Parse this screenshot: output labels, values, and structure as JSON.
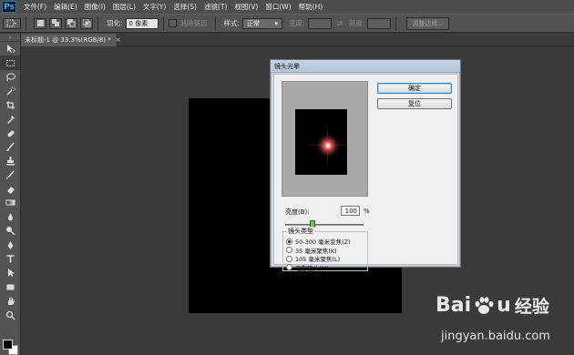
{
  "app": {
    "logo": "Ps"
  },
  "menu": [
    "文件(F)",
    "编辑(E)",
    "图像(I)",
    "图层(L)",
    "文字(Y)",
    "选择(S)",
    "滤镜(T)",
    "视图(V)",
    "窗口(W)",
    "帮助(H)"
  ],
  "options": {
    "feather_label": "羽化:",
    "feather_value": "0 像素",
    "antialias_label": "消除锯齿",
    "style_label": "样式:",
    "style_value": "正常",
    "width_label": "宽度:",
    "height_label": "高度:",
    "refine_edge_label": "调整边缘..."
  },
  "document": {
    "tab_title": "未标题-1 @ 33.3%(RGB/8) *",
    "tab_close": "×"
  },
  "dialog": {
    "title": "镜头光晕",
    "ok_label": "确定",
    "reset_label": "复位",
    "brightness_label": "亮度(B):",
    "brightness_value": "100",
    "brightness_unit": "%",
    "brightness_slider_fraction": 0.35,
    "lens_type_title": "镜头类型",
    "lens_types": [
      {
        "label": "50-300 毫米变焦(Z)",
        "selected": true
      },
      {
        "label": "35 毫米聚焦(K)",
        "selected": false
      },
      {
        "label": "105 毫米聚焦(L)",
        "selected": false
      },
      {
        "label": "电影镜头(M)",
        "selected": false
      }
    ]
  },
  "toolbar": {
    "tools": [
      "move-tool",
      "marquee-tool",
      "lasso-tool",
      "quick-select-tool",
      "crop-tool",
      "eyedropper-tool",
      "healing-brush-tool",
      "brush-tool",
      "clone-stamp-tool",
      "history-brush-tool",
      "eraser-tool",
      "gradient-tool",
      "blur-tool",
      "dodge-tool",
      "pen-tool",
      "type-tool",
      "path-select-tool",
      "rectangle-tool",
      "hand-tool",
      "zoom-tool"
    ],
    "active_tool": "marquee-tool",
    "foreground_color": "#000000",
    "background_color": "#ffffff"
  },
  "watermark": {
    "brand": "Bai",
    "brand_tail": "u",
    "brand_cn": "经验",
    "url": "jingyan.baidu.com"
  }
}
